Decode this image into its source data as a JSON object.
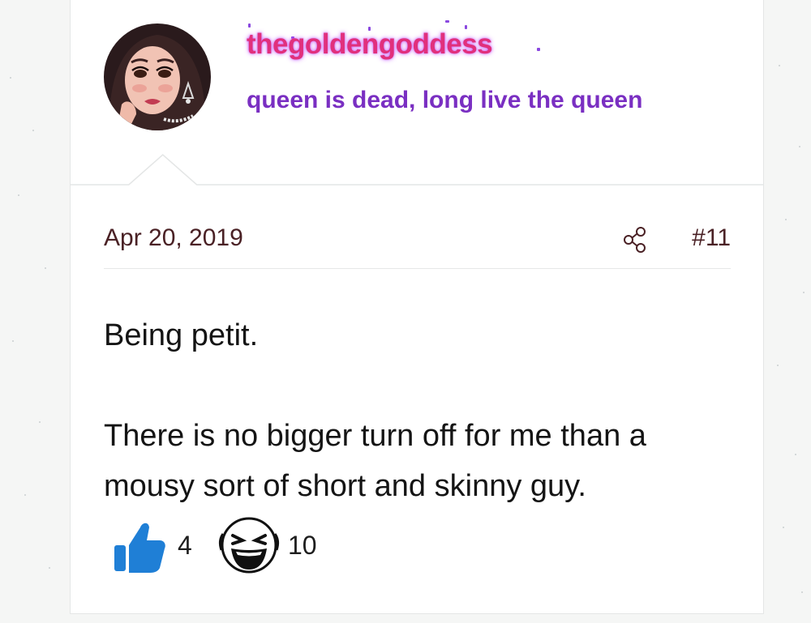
{
  "post": {
    "author": {
      "username": "thegoldengoddess",
      "user_title": "queen is dead, long live the queen",
      "avatar_icon": "avatar-icon"
    },
    "date": "Apr 20, 2019",
    "share_icon": "share-icon",
    "number": "#11",
    "body": [
      "Being petit.",
      "There is no bigger turn off for me than a mousy sort of short and skinny guy."
    ],
    "reactions": [
      {
        "icon": "thumbs-up-icon",
        "count": "4",
        "color": "#1f7fd6"
      },
      {
        "icon": "laughing-face-icon",
        "count": "10",
        "color": "#111111"
      }
    ]
  },
  "colors": {
    "username": "#e1307c",
    "username_glow": "#be3cff",
    "user_title": "#7a2fc2",
    "meta_text": "#4a2125",
    "body_text": "#141414",
    "background": "#f5f6f5",
    "card": "#ffffff"
  }
}
